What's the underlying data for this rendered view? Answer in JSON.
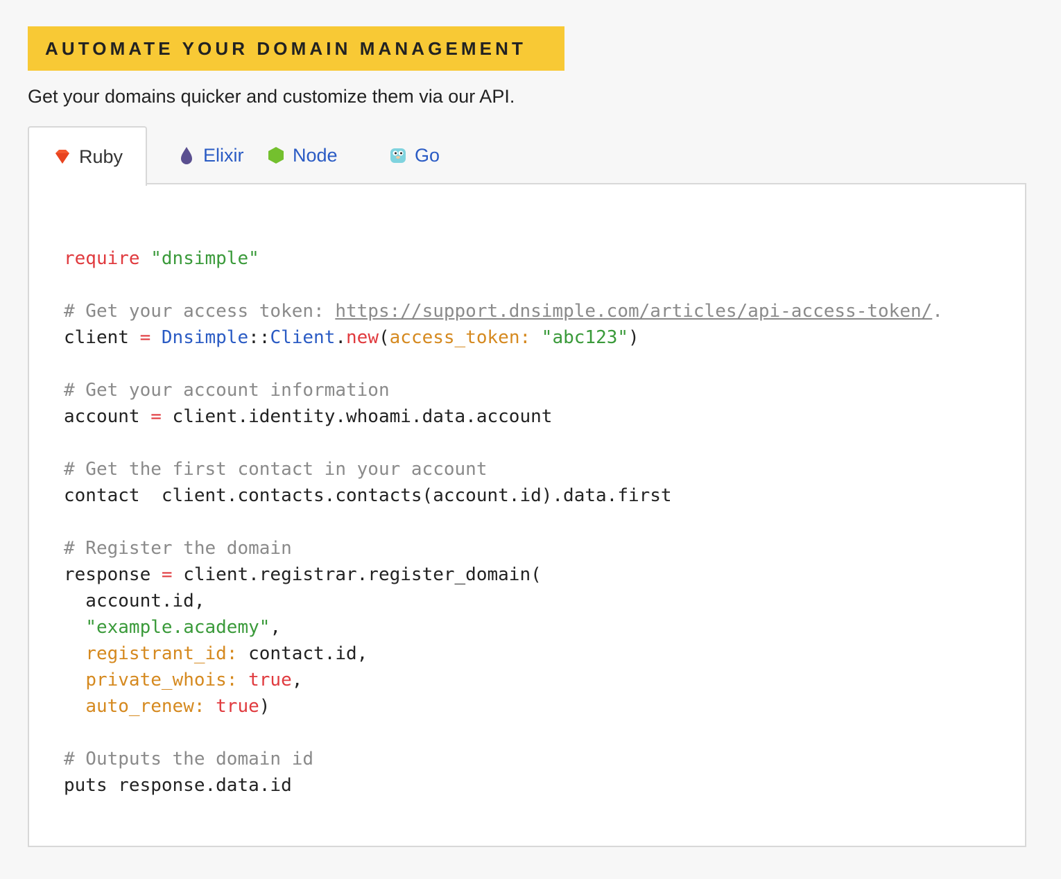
{
  "banner": {
    "title": "AUTOMATE YOUR DOMAIN MANAGEMENT"
  },
  "subtitle": "Get your domains quicker and customize them via our API.",
  "tabs": [
    {
      "label": "Ruby",
      "icon": "ruby-gem-icon",
      "active": true
    },
    {
      "label": "Elixir",
      "icon": "elixir-drop-icon",
      "active": false
    },
    {
      "label": "Node",
      "icon": "node-hexagon-icon",
      "active": false
    },
    {
      "label": "Go",
      "icon": "go-gopher-icon",
      "active": false
    }
  ],
  "colors": {
    "banner": "#f8c935",
    "tab_link": "#2a5bc4",
    "keyword": "#e03a3e",
    "string": "#3a9a3a",
    "comment": "#8a8a8a",
    "symbol": "#d5891f",
    "class": "#2a5bc4"
  },
  "code": {
    "require_kw": "require",
    "require_str": "\"dnsimple\"",
    "comment_token": "# Get your access token: ",
    "token_url": "https://support.dnsimple.com/articles/api-access-token/",
    "token_url_tail": ".",
    "client_var": "client ",
    "op_eq": "=",
    "dnsimple_cls": "Dnsimple",
    "sep": "::",
    "client_cls": "Client",
    "dot": ".",
    "new_kw": "new",
    "paren_open": "(",
    "access_token_sym": "access_token:",
    "abc_str": "\"abc123\"",
    "paren_close": ")",
    "comment_account": "# Get your account information",
    "account_var": "account ",
    "account_rhs": " client.identity.whoami.data.account",
    "comment_contact": "# Get the first contact in your account",
    "contact_line": "contact  client.contacts.contacts(account.id).data.first",
    "comment_register": "# Register the domain",
    "response_var": "response ",
    "response_rhs": " client.registrar.register_domain(",
    "arg_account": "  account.id,",
    "arg_domain_str": "\"example.academy\"",
    "comma": ",",
    "registrant_sym": "registrant_id:",
    "registrant_val": " contact.id,",
    "private_sym": "private_whois:",
    "true_kw": "true",
    "auto_sym": "auto_renew:",
    "comment_outputs": "# Outputs the domain id",
    "puts_line": "puts response.data.id"
  }
}
